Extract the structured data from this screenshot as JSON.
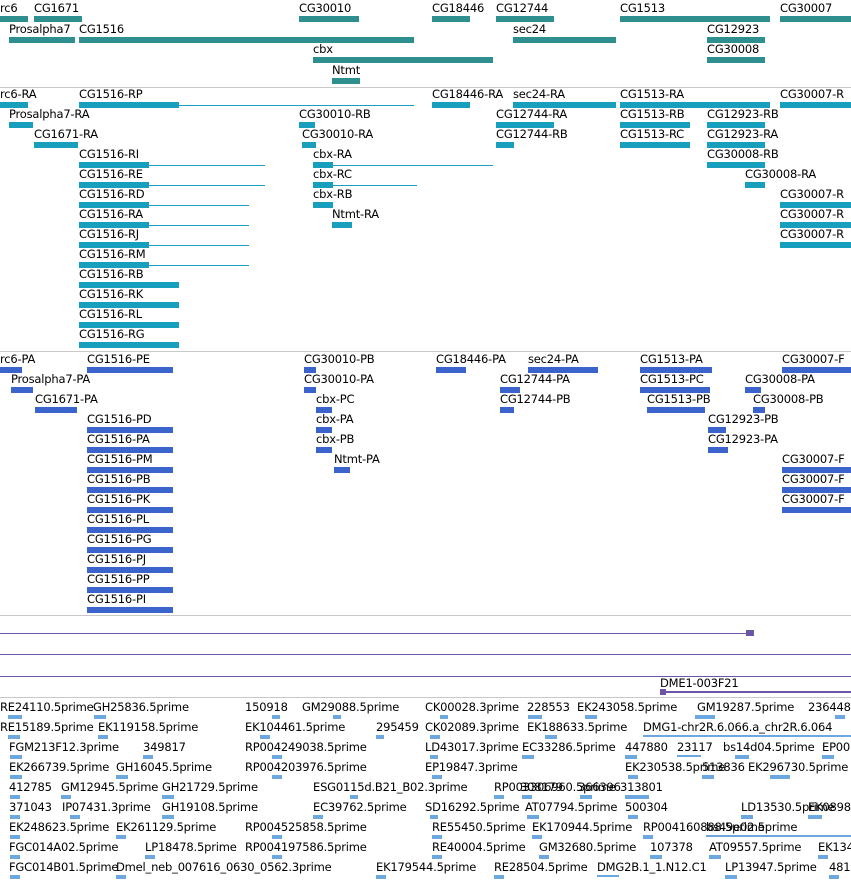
{
  "colors": {
    "gene": "#2f8f8f",
    "transcript": "#179fbd",
    "protein": "#3a64cc",
    "alignment": "#6b55a6",
    "est": "#6ca7dd"
  },
  "gene_track": {
    "labels": [
      "rc6",
      "CG1671",
      "CG30010",
      "CG18446",
      "CG12744",
      "CG1513",
      "CG30007",
      "Prosalpha7",
      "CG1516",
      "sec24",
      "CG12923",
      "cbx",
      "CG30008",
      "Ntmt"
    ]
  },
  "transcript_track": {
    "labels": [
      "rc6-RA",
      "CG1516-RP",
      "CG18446-RA",
      "sec24-RA",
      "CG1513-RA",
      "CG30007-R",
      "Prosalpha7-RA",
      "CG30010-RB",
      "CG12744-RA",
      "CG1513-RB",
      "CG12923-RB",
      "CG1671-RA",
      "CG30010-RA",
      "CG12744-RB",
      "CG1513-RC",
      "CG12923-RA",
      "CG1516-RI",
      "cbx-RA",
      "CG30008-RB",
      "CG1516-RE",
      "cbx-RC",
      "CG30008-RA",
      "CG1516-RD",
      "cbx-RB",
      "CG30007-R",
      "CG1516-RA",
      "Ntmt-RA",
      "CG30007-R",
      "CG1516-RJ",
      "CG30007-R",
      "CG1516-RM",
      "CG1516-RB",
      "CG1516-RK",
      "CG1516-RL",
      "CG1516-RG"
    ]
  },
  "protein_track": {
    "labels": [
      "rc6-PA",
      "CG1516-PE",
      "CG30010-PB",
      "CG18446-PA",
      "sec24-PA",
      "CG1513-PA",
      "CG30007-F",
      "Prosalpha7-PA",
      "CG30010-PA",
      "CG12744-PA",
      "CG1513-PC",
      "CG30008-PA",
      "CG1671-PA",
      "cbx-PC",
      "CG12744-PB",
      "CG1513-PB",
      "CG30008-PB",
      "CG1516-PD",
      "cbx-PA",
      "CG12923-PB",
      "CG1516-PA",
      "cbx-PB",
      "CG12923-PA",
      "CG1516-PM",
      "Ntmt-PA",
      "CG30007-F",
      "CG1516-PB",
      "CG30007-F",
      "CG1516-PK",
      "CG30007-F",
      "CG1516-PL",
      "CG1516-PG",
      "CG1516-PJ",
      "CG1516-PP",
      "CG1516-PI"
    ]
  },
  "alignment_track": {
    "labels": [
      "DME1-003F21"
    ]
  },
  "est_track": {
    "labels": [
      "RE24110.5prime",
      "GH25836.5prime",
      "150918",
      "GM29088.5prime",
      "CK00028.3prime",
      "228553",
      "EK243058.5prime",
      "GM19287.5prime",
      "236448",
      "RE15189.5prime",
      "EK119158.5prime",
      "EK104461.5prime",
      "295459",
      "CK02089.3prime",
      "EK188633.5prime",
      "DMG1-chr2R.6.066.a_chr2R.6.064",
      "FGM213F12.3prime",
      "349817",
      "RP004249038.5prime",
      "LD43017.3prime",
      "EC33286.5prime",
      "447880",
      "23117",
      "bs14d04.5prime",
      "EP00",
      "EK266739.5prime",
      "GH16045.5prime",
      "RP004203976.5prime",
      "EP19847.3prime",
      "EK230538.5prime",
      "513836",
      "EK296730.5prime",
      "412785",
      "GM12945.5prime",
      "GH21729.5prime",
      "ESG0115d.B21_B02.3prime",
      "RP003306960.5prime",
      "308179",
      "366396",
      "313801",
      "371043",
      "IP07431.3prime",
      "GH19108.5prime",
      "EC39762.5prime",
      "SD16292.5prime",
      "AT07794.5prime",
      "500304",
      "LD13530.5prime",
      "EK0898",
      "EK248623.5prime",
      "EK261129.5prime",
      "RP004525858.5prime",
      "bs49e02.5prime",
      "RE55450.5prime",
      "EK170944.5prime",
      "RP004160888.5prime",
      "FGC014A02.5prime",
      "LP18478.5prime",
      "RP004197586.5prime",
      "RE40004.5prime",
      "GM32680.5prime",
      "107378",
      "AT09557.5prime",
      "EK134",
      "FGC014B01.5prime",
      "Dmel_neb_007616_0630_0562.3prime",
      "EK179544.5prime",
      "RE28504.5prime",
      "DMG2B.1_1.N12.C1",
      "LP13947.5prime",
      "4816"
    ]
  }
}
